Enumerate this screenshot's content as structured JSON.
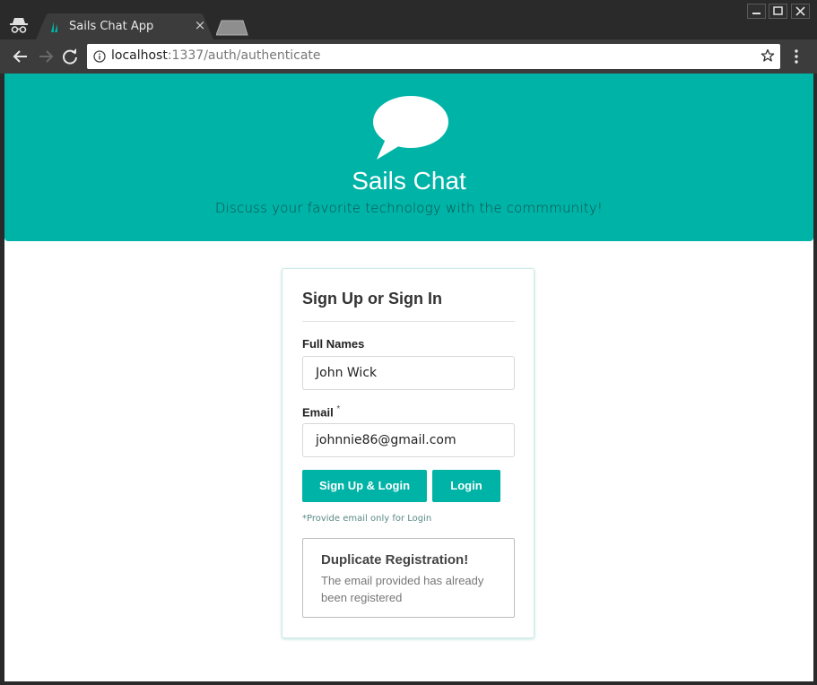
{
  "browser": {
    "tab_title": "Sails Chat App",
    "tab_close": "×",
    "url_host": "localhost",
    "url_path": ":1337/auth/authenticate"
  },
  "hero": {
    "title": "Sails Chat",
    "subtitle": "Discuss your favorite technology with the commmunity!"
  },
  "form": {
    "heading": "Sign Up or Sign In",
    "full_names_label": "Full Names",
    "full_names_value": "John Wick",
    "email_label": "Email",
    "email_required_mark": "*",
    "email_value": "johnnie86@gmail.com",
    "signup_button": "Sign Up & Login",
    "login_button": "Login",
    "hint": "*Provide email only for Login"
  },
  "alert": {
    "title": "Duplicate Registration!",
    "message": "The email provided has already been registered"
  },
  "colors": {
    "accent": "#00b3a7",
    "chrome_dark": "#2a2a2a",
    "toolbar": "#3c3c3c"
  }
}
